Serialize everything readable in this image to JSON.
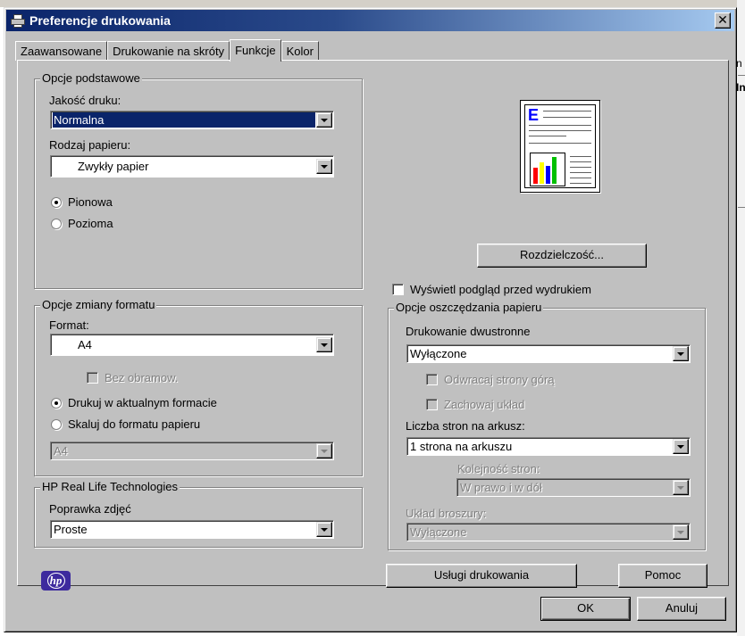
{
  "window": {
    "title": "Preferencje drukowania",
    "close_label": "✕"
  },
  "tabs": [
    {
      "label": "Zaawansowane",
      "active": false
    },
    {
      "label": "Drukowanie na skróty",
      "active": false
    },
    {
      "label": "Funkcje",
      "active": true
    },
    {
      "label": "Kolor",
      "active": false
    }
  ],
  "basic": {
    "title": "Opcje podstawowe",
    "quality_label": "Jakość druku:",
    "quality_value": "Normalna",
    "paper_label": "Rodzaj papieru:",
    "paper_value": "Zwykły papier",
    "portrait_label": "Pionowa",
    "landscape_label": "Pozioma"
  },
  "format": {
    "title": "Opcje zmiany formatu",
    "format_label": "Format:",
    "format_value": "A4",
    "borderless_label": "Bez obramow.",
    "current_label": "Drukuj w aktualnym formacie",
    "scale_label": "Skaluj do formatu papieru",
    "scale_value": "A4"
  },
  "hp": {
    "title": "HP Real Life Technologies",
    "photo_label": "Poprawka zdjęć",
    "photo_value": "Proste",
    "logo_text": "hp"
  },
  "right": {
    "resolution_button": "Rozdzielczość...",
    "preview_check_label": "Wyświetl podgląd przed wydrukiem",
    "preview_letter": "E"
  },
  "paper_saving": {
    "title": "Opcje oszczędzania papieru",
    "duplex_label": "Drukowanie dwustronne",
    "duplex_value": "Wyłączone",
    "flip_label": "Odwracaj strony górą",
    "keep_label": "Zachowaj układ",
    "pages_label": "Liczba stron na arkusz:",
    "pages_value": "1 strona na arkuszu",
    "order_label": "Kolejność stron:",
    "order_value": "W prawo i w dół",
    "booklet_label": "Układ broszury:",
    "booklet_value": "Wyłączone"
  },
  "buttons": {
    "services": "Usługi drukowania",
    "help": "Pomoc",
    "ok": "OK",
    "cancel": "Anuluj"
  },
  "colors": {
    "title_start": "#0a246a",
    "title_end": "#a6caf0",
    "face": "#c0c0c0",
    "selection": "#0a246a",
    "preview_letter": "#0000ff",
    "logo": "#3d2a9e"
  },
  "background": {
    "frag_1": "n",
    "frag_2": "In"
  }
}
